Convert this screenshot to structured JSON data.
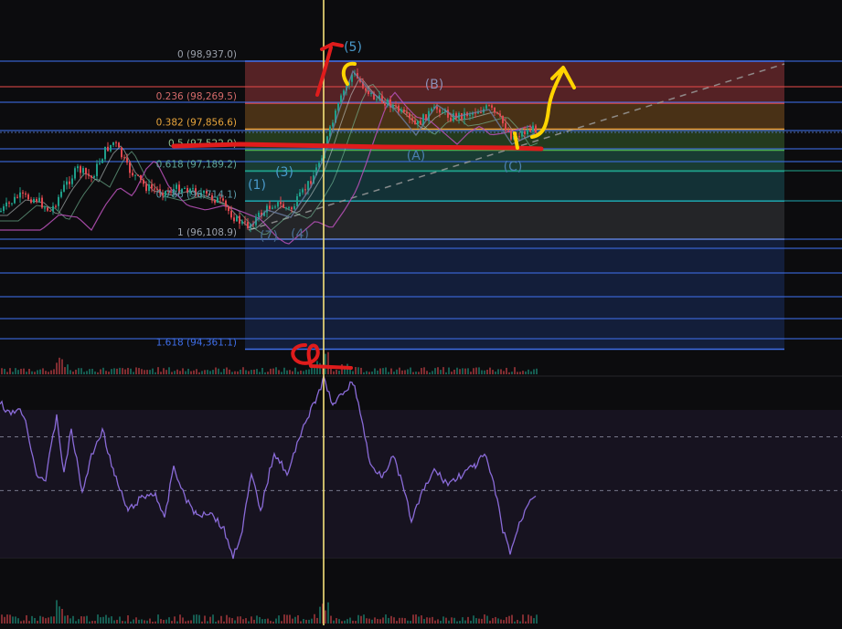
{
  "colors": {
    "background": "#0c0c0e",
    "candle_up": "#1f9e89",
    "candle_down": "#e0484f",
    "ma_line": "#b34fb3",
    "rsi_line": "#8a6bd8",
    "fib_line_blue": "#3f6ee8",
    "fib_line_red": "#e04848",
    "annotation_red": "#e01c1c",
    "annotation_yellow": "#ffd400",
    "wave_label": "#4a9acb",
    "corrective_label": "#8a8fb5",
    "cursor_line": "#f5e27a"
  },
  "chart_data": [
    {
      "type": "candlestick",
      "panel": "price",
      "fib_levels": [
        {
          "ratio_label": "0",
          "price": "98,937.0",
          "value": 98937.0,
          "color": "#3f6ee8",
          "label_color": "#9aa0aa"
        },
        {
          "ratio_label": "0.236",
          "price": "98,269.5",
          "value": 98269.5,
          "color": "#e04848",
          "label_color": "#d46a6a"
        },
        {
          "ratio_label": "0.382",
          "price": "97,856.6",
          "value": 97856.6,
          "color": "#f0a030",
          "label_color": "#e8a53c"
        },
        {
          "ratio_label": "0.5",
          "price": "97,522.9",
          "value": 97522.9,
          "color": "#4caf50",
          "label_color": "#8fbf8f"
        },
        {
          "ratio_label": "0.618",
          "price": "97,189.2",
          "value": 97189.2,
          "color": "#1f9e89",
          "label_color": "#5fa89a"
        },
        {
          "ratio_label": "0.786",
          "price": "96,714.1",
          "value": 96714.1,
          "color": "#1fa0a8",
          "label_color": "#5a9aa8"
        },
        {
          "ratio_label": "1",
          "price": "96,108.9",
          "value": 96108.9,
          "color": "#8a8f98",
          "label_color": "#9aa0aa"
        },
        {
          "ratio_label": "1.618",
          "price": "94,361.1",
          "value": 94361.1,
          "color": "#3f6ee8",
          "label_color": "#3f6ee8"
        }
      ],
      "fib_zones": [
        {
          "from": "0",
          "to": "0.236",
          "color": "#6e2a2e"
        },
        {
          "from": "0.236",
          "to": "0.382",
          "color": "#5e3e1a"
        },
        {
          "from": "0.382",
          "to": "0.5",
          "color": "#2c4a24"
        },
        {
          "from": "0.5",
          "to": "0.618",
          "color": "#1e4c40"
        },
        {
          "from": "0.618",
          "to": "0.786",
          "color": "#163e44"
        },
        {
          "from": "0.786",
          "to": "1",
          "color": "#2c2e32"
        },
        {
          "from": "1",
          "to": "1.618",
          "color": "#15244a"
        }
      ],
      "wave_labels": [
        {
          "text": "(1)",
          "color": "#4a9acb"
        },
        {
          "text": "(7)",
          "color": "#4a6f95"
        },
        {
          "text": "(3)",
          "color": "#4a9acb"
        },
        {
          "text": "(4)",
          "color": "#4a6f95"
        },
        {
          "text": "(5)",
          "color": "#4a9acb"
        },
        {
          "text": "(A)",
          "color": "#4a7fb0"
        },
        {
          "text": "(B)",
          "color": "#8a8fb5"
        },
        {
          "text": "(C)",
          "color": "#4a7fb0"
        }
      ]
    },
    {
      "type": "bar",
      "panel": "volume"
    },
    {
      "type": "line",
      "panel": "rsi",
      "reference_lines": [
        70,
        50
      ]
    }
  ]
}
